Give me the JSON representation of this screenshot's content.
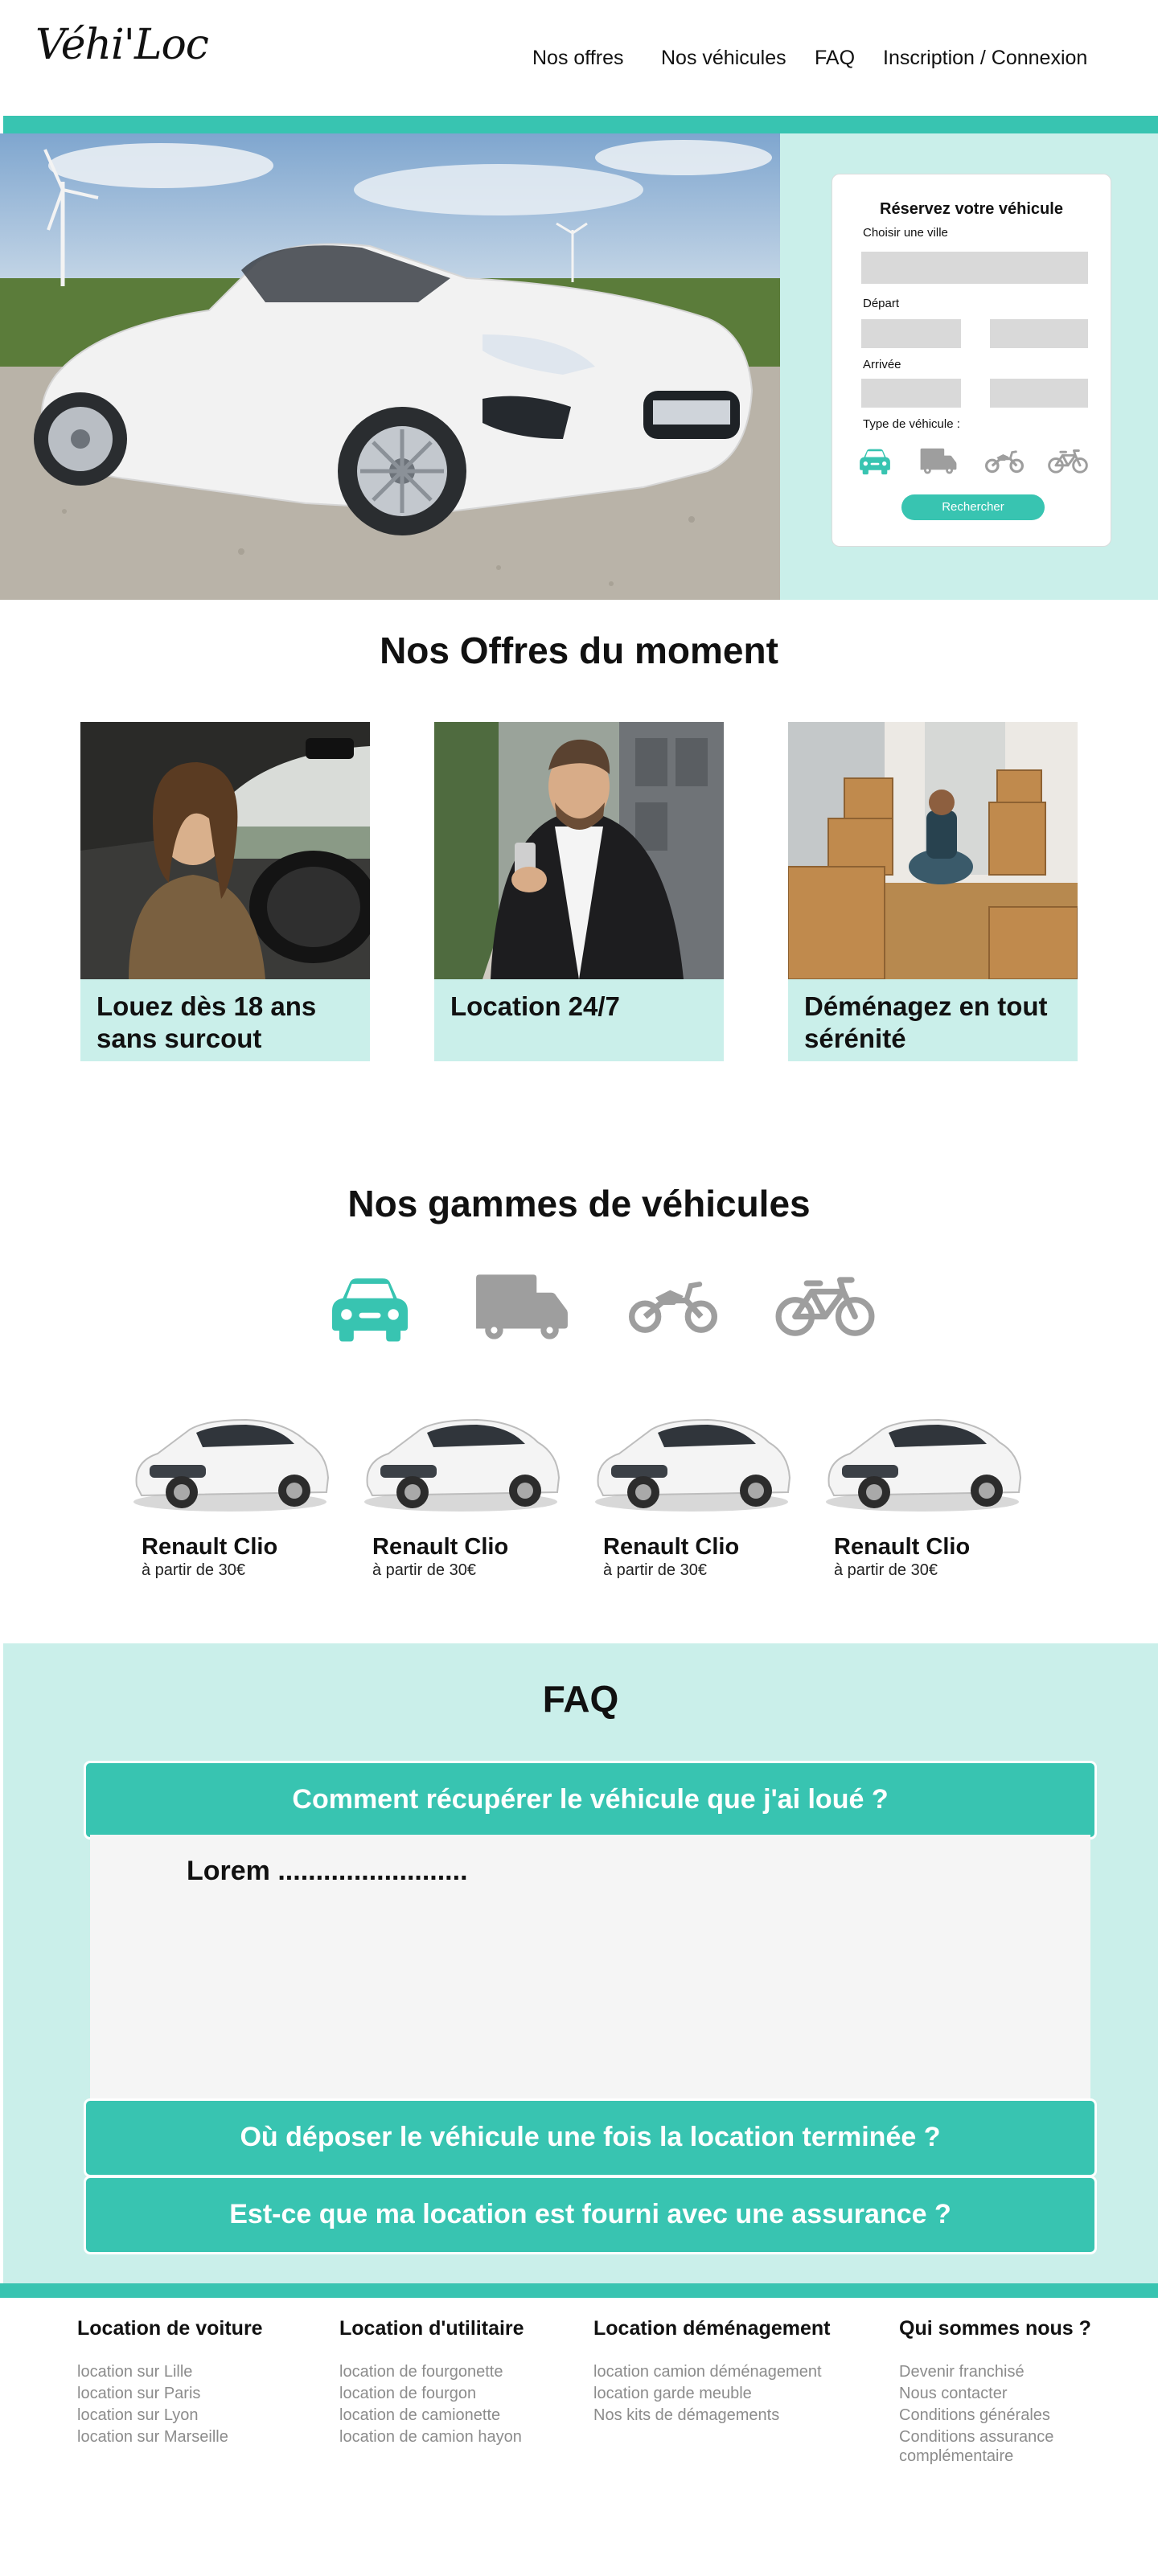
{
  "header": {
    "logo": "Véhi'Loc",
    "nav": [
      "Nos offres",
      "Nos véhicules",
      "FAQ",
      "Inscription / Connexion"
    ]
  },
  "booking": {
    "title": "Réservez votre véhicule",
    "city_label": "Choisir une ville",
    "depart_label": "Départ",
    "arrivee_label": "Arrivée",
    "type_label": "Type de véhicule :",
    "vehicle_types": [
      "car-icon",
      "truck-icon",
      "motorbike-icon",
      "bicycle-icon"
    ],
    "selected_type": "car-icon",
    "search_button": "Rechercher"
  },
  "offers": {
    "title": "Nos Offres du moment",
    "items": [
      {
        "caption": "Louez dès 18 ans sans surcout"
      },
      {
        "caption": "Location 24/7"
      },
      {
        "caption": "Déménagez en tout sérénité"
      }
    ]
  },
  "gammes": {
    "title": "Nos gammes de véhicules",
    "icons": [
      "car-icon",
      "truck-icon",
      "motorbike-icon",
      "bicycle-icon"
    ],
    "selected": "car-icon",
    "cars": [
      {
        "name": "Renault Clio",
        "price": "à partir de 30€"
      },
      {
        "name": "Renault Clio",
        "price": "à partir de 30€"
      },
      {
        "name": "Renault Clio",
        "price": "à partir de 30€"
      },
      {
        "name": "Renault Clio",
        "price": "à partir de 30€"
      }
    ]
  },
  "faq": {
    "title": "FAQ",
    "questions": [
      {
        "q": "Comment récupérer le véhicule que j'ai loué  ?",
        "a": "Lorem ........................."
      },
      {
        "q": "Où déposer le véhicule une fois la location terminée ?"
      },
      {
        "q": "Est-ce que ma location est fourni avec une assurance ?"
      }
    ]
  },
  "footer": {
    "columns": [
      {
        "title": "Location de voiture",
        "links": [
          "location sur Lille",
          "location sur Paris",
          "location sur Lyon",
          "location sur Marseille"
        ]
      },
      {
        "title": "Location d'utilitaire",
        "links": [
          "location de fourgonette",
          "location de fourgon",
          "location de camionette",
          "location de camion hayon"
        ]
      },
      {
        "title": "Location déménagement",
        "links": [
          "location camion déménagement",
          "location garde meuble",
          "Nos kits de démagements"
        ]
      },
      {
        "title": "Qui sommes nous ?",
        "links": [
          "Devenir franchisé",
          "Nous contacter",
          "Conditions générales",
          "Conditions assurance",
          "complémentaire"
        ]
      }
    ]
  },
  "colors": {
    "accent": "#38c4b1",
    "accent_light": "#caefea",
    "icon_inactive": "#9e9e9e",
    "field": "#d9d9d9"
  }
}
